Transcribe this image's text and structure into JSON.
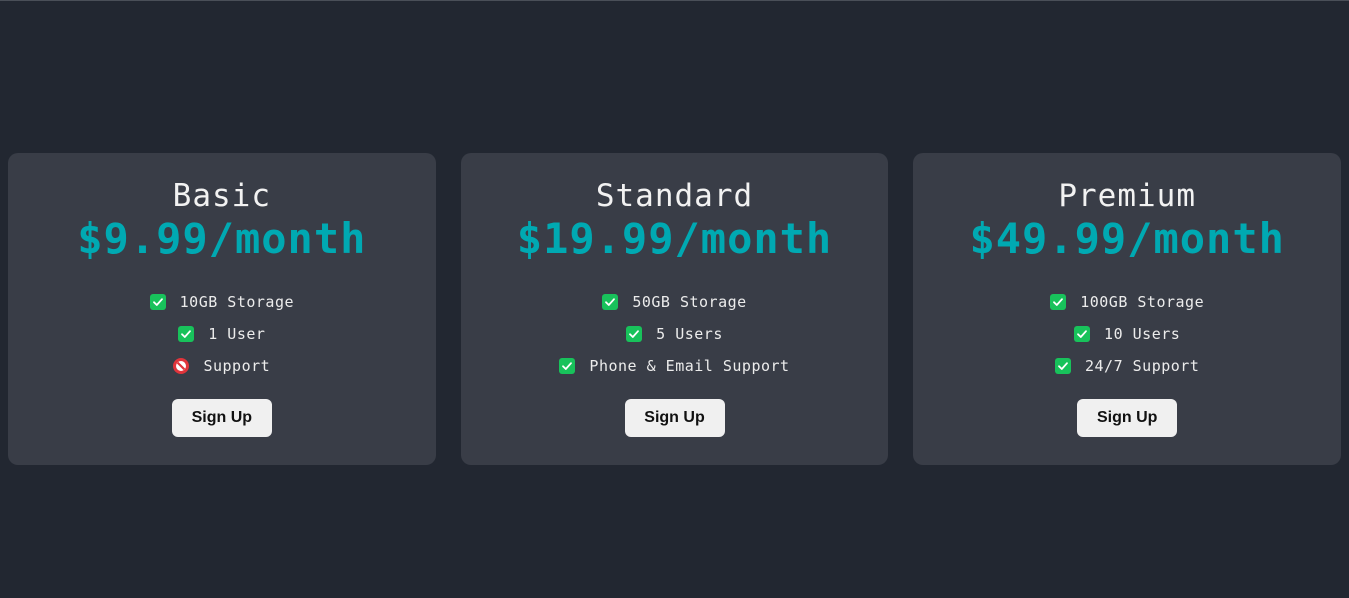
{
  "plans": [
    {
      "name": "Basic",
      "price": "$9.99/month",
      "features": [
        {
          "icon": "check-icon",
          "text": "10GB Storage"
        },
        {
          "icon": "check-icon",
          "text": "1 User"
        },
        {
          "icon": "prohibited-icon",
          "text": "Support"
        }
      ],
      "button_label": "Sign Up"
    },
    {
      "name": "Standard",
      "price": "$19.99/month",
      "features": [
        {
          "icon": "check-icon",
          "text": "50GB Storage"
        },
        {
          "icon": "check-icon",
          "text": "5 Users"
        },
        {
          "icon": "check-icon",
          "text": "Phone & Email Support"
        }
      ],
      "button_label": "Sign Up"
    },
    {
      "name": "Premium",
      "price": "$49.99/month",
      "features": [
        {
          "icon": "check-icon",
          "text": "100GB Storage"
        },
        {
          "icon": "check-icon",
          "text": "10 Users"
        },
        {
          "icon": "check-icon",
          "text": "24/7 Support"
        }
      ],
      "button_label": "Sign Up"
    }
  ],
  "colors": {
    "background": "#222731",
    "card": "#393d47",
    "price": "#00a9b2",
    "check": "#18c25b",
    "prohibited": "#e0343b"
  }
}
